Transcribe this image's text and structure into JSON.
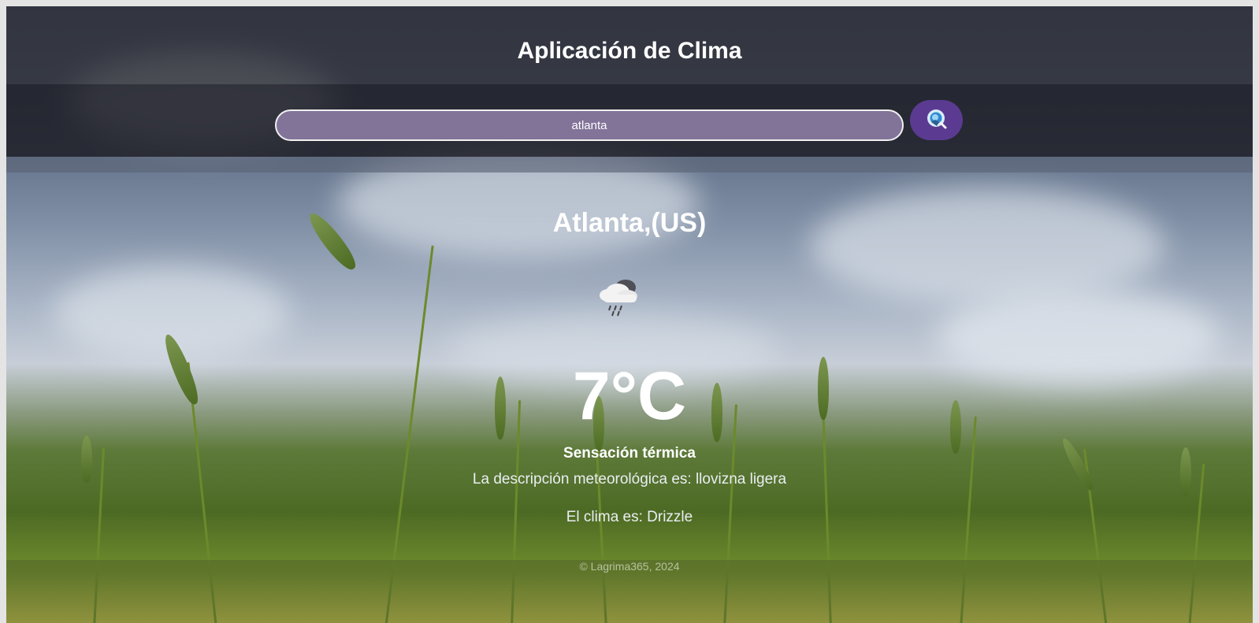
{
  "header": {
    "title": "Aplicación de Clima"
  },
  "search": {
    "value": "atlanta",
    "button_icon": "search-icon"
  },
  "weather": {
    "location": "Atlanta,(US)",
    "icon": "rain-cloud-icon",
    "temperature": "7°C",
    "feels_like_label": "Sensación térmica",
    "description": "La descripción meteorológica es: llovizna ligera",
    "condition": "El clima es: Drizzle"
  },
  "footer": {
    "copyright": "© Lagrima365, 2024"
  },
  "colors": {
    "header_bg": "#303036",
    "search_bg": "#827399",
    "button_bg": "#5b3b91",
    "text": "#ffffff"
  }
}
